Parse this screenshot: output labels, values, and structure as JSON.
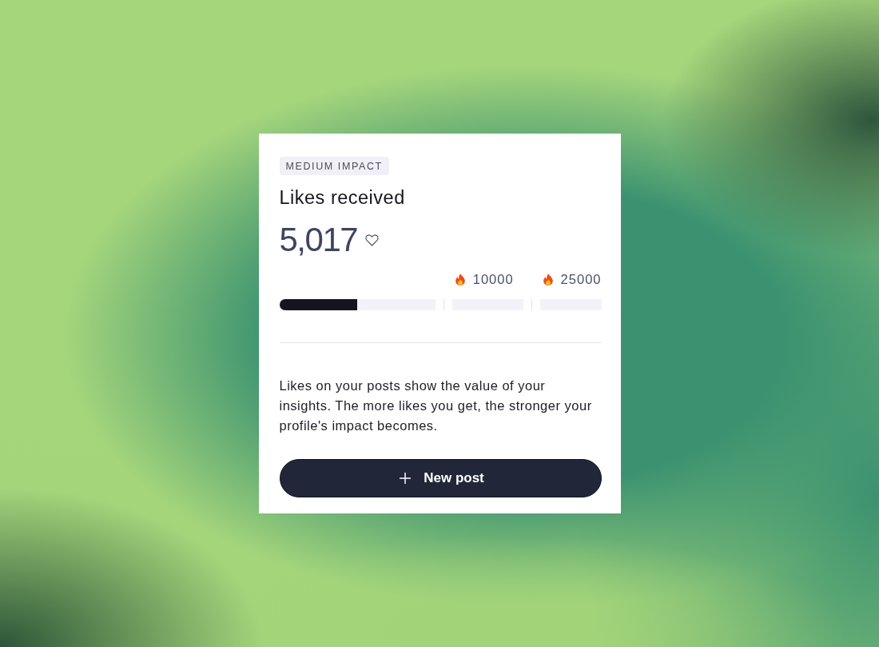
{
  "card": {
    "badge": "MEDIUM IMPACT",
    "title": "Likes received",
    "count": "5,017",
    "milestones": [
      {
        "label": "10000"
      },
      {
        "label": "25000"
      }
    ],
    "progress": {
      "level": 0.243
    },
    "description": "Likes on your posts show the value of your insights. The more likes you get, the stronger your profile's impact becomes.",
    "button": {
      "label": "New post"
    }
  }
}
